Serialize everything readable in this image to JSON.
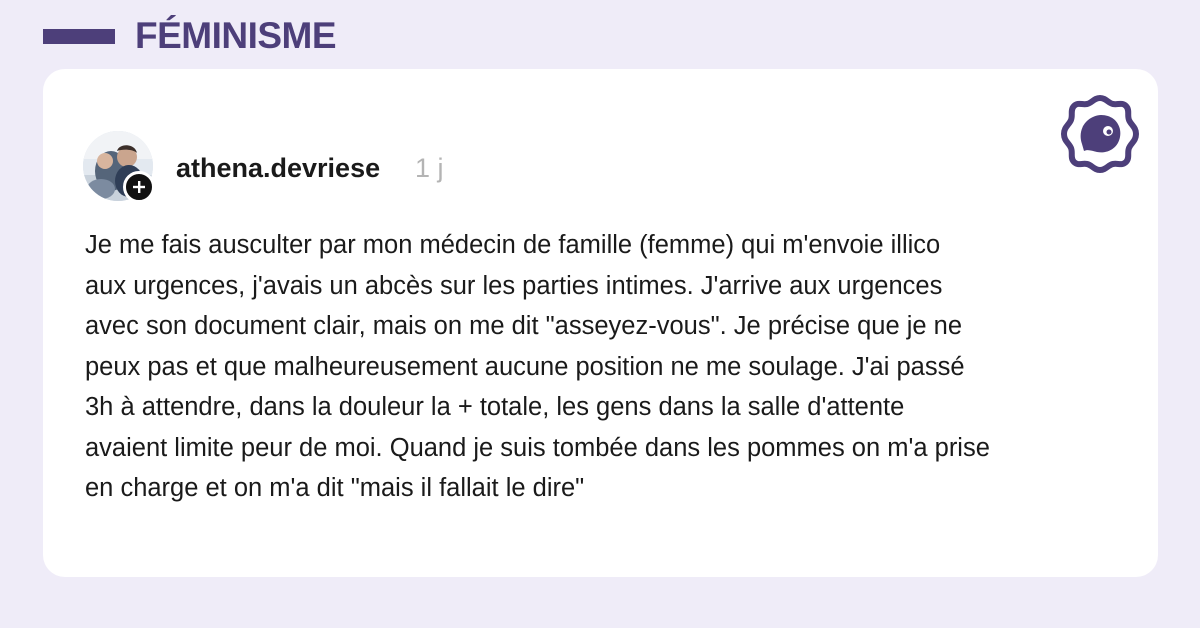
{
  "category": {
    "label": "FÉMINISME"
  },
  "post": {
    "username": "athena.devriese",
    "timestamp": "1 j",
    "avatar_icon": "profile-photo",
    "follow_icon": "plus-icon",
    "lines": [
      "Je me fais ausculter par mon médecin de famille (femme) qui m'envoie illico",
      "aux urgences, j'avais un abcès sur les parties intimes. J'arrive aux urgences",
      "avec son document clair, mais on me dit \"asseyez-vous\". Je précise que je ne",
      "peux pas et que malheureusement aucune position ne me soulage. J'ai passé",
      "3h à attendre, dans la douleur la + totale, les gens dans la salle d'attente",
      "avaient limite peur de moi. Quand je suis tombée dans les pommes on m'a prise",
      "en charge et on m'a dit \"mais il fallait le dire\""
    ]
  },
  "brand": {
    "icon": "brand-logo-icon"
  },
  "colors": {
    "background": "#efecf8",
    "accent": "#4d3f7a",
    "card": "#ffffff",
    "text": "#1a1a1a",
    "muted": "#b4b4b4"
  }
}
